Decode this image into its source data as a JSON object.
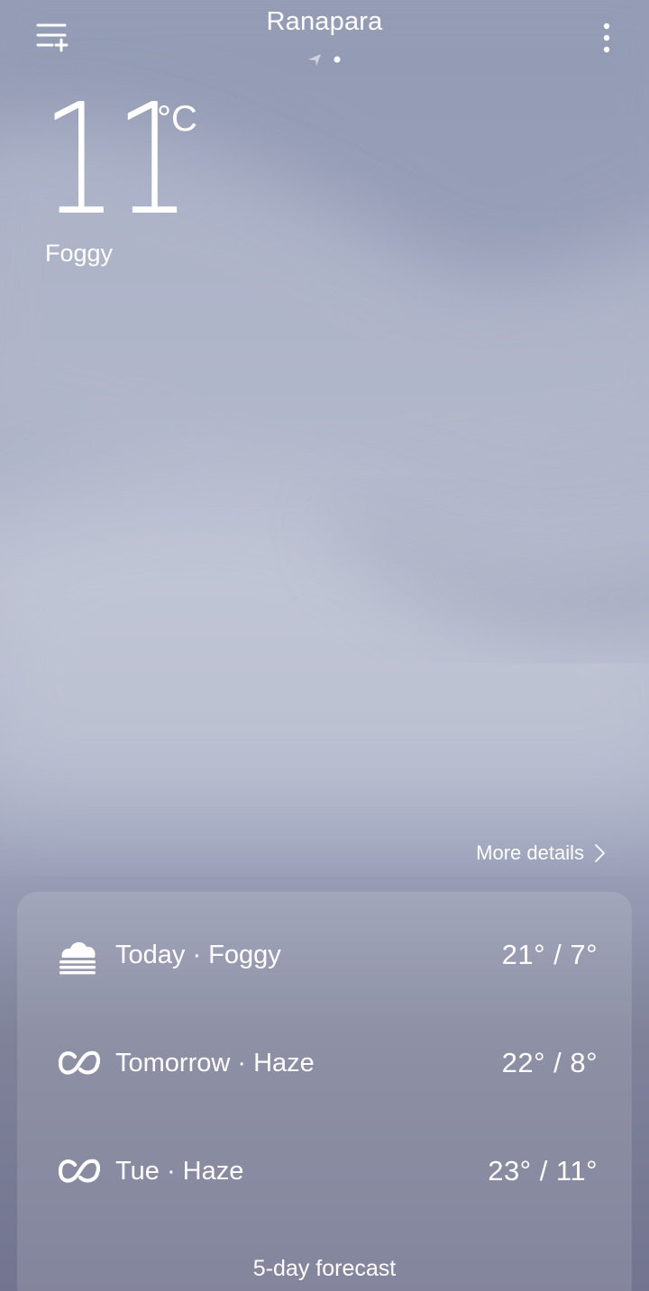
{
  "header": {
    "city": "Ranapara",
    "menu_icon": "add-city-icon",
    "more_icon": "more-vertical-icon"
  },
  "current": {
    "temperature": "11",
    "unit": "°C",
    "condition": "Foggy"
  },
  "more_details_label": "More details",
  "forecast": {
    "days": [
      {
        "label": "Today · Foggy",
        "temps": "21° / 7°",
        "icon": "fog-icon"
      },
      {
        "label": "Tomorrow · Haze",
        "temps": "22° / 8°",
        "icon": "haze-icon"
      },
      {
        "label": "Tue · Haze",
        "temps": "23° / 11°",
        "icon": "haze-icon"
      }
    ],
    "five_day_label": "5-day forecast"
  },
  "colors": {
    "text": "#ffffff",
    "background_top": "#9ba3bb",
    "background_bottom": "#737590"
  }
}
